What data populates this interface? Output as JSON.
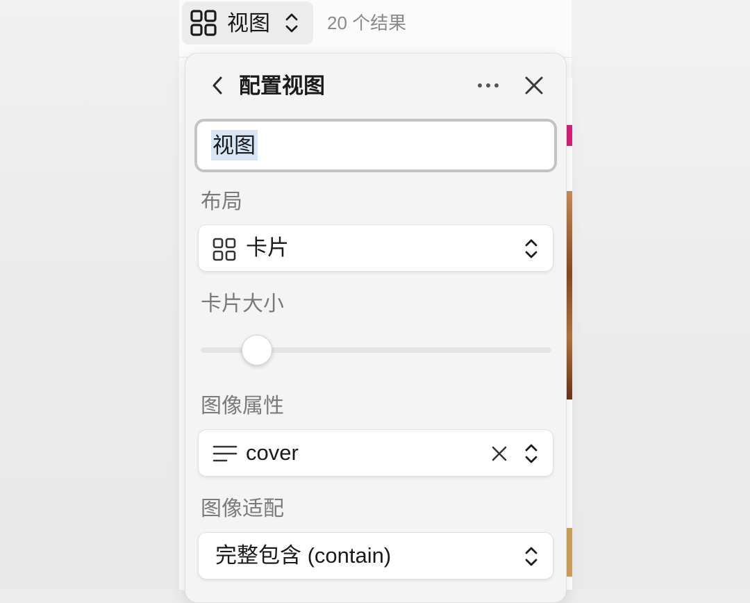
{
  "toolbar": {
    "view_button_label": "视图",
    "result_count": "20 个结果"
  },
  "panel": {
    "title": "配置视图",
    "view_name_value": "视图",
    "layout": {
      "label": "布局",
      "value": "卡片",
      "icon": "grid-icon"
    },
    "card_size": {
      "label": "卡片大小",
      "level": 0.16
    },
    "image_property": {
      "label": "图像属性",
      "value": "cover",
      "icon": "text-lines-icon"
    },
    "image_fit": {
      "label": "图像适配",
      "value": "完整包含 (contain)"
    }
  },
  "colors": {
    "panel_bg": "#f4f4f4",
    "selection_highlight": "#d7e6f5",
    "label_gray": "#7a7a7a"
  }
}
